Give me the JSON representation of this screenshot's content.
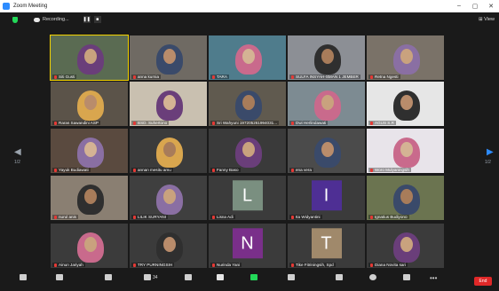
{
  "window": {
    "title": "Zoom Meeting",
    "controls": [
      "–",
      "▢",
      "✕"
    ]
  },
  "topbar": {
    "recording": "Recording...",
    "view": "View"
  },
  "pagination": {
    "left": "1/2",
    "right": "1/2"
  },
  "participants": [
    {
      "name": "Siti Gusti"
    },
    {
      "name": "anna kurnia"
    },
    {
      "name": "TARA"
    },
    {
      "name": "SULFA INSYAH-SMAN 1 JEMBER"
    },
    {
      "name": "Retna Ngesti"
    },
    {
      "name": "Raras Sawandini ASP"
    },
    {
      "name": "BSD. Suhertono"
    },
    {
      "name": "Sri Wahyuni 197205261994031..."
    },
    {
      "name": "Dwi Herlindawati"
    },
    {
      "name": "AGUS S.R"
    },
    {
      "name": "Yayuk Budiawati"
    },
    {
      "name": "annan mesitu amu"
    },
    {
      "name": "Fanny Baso"
    },
    {
      "name": "ena vera"
    },
    {
      "name": "Woro Mulyaningsih"
    },
    {
      "name": "nurul anis"
    },
    {
      "name": "LILIK SURYANI"
    },
    {
      "name": "Lisna Adi",
      "letter": "L"
    },
    {
      "name": "Ita Widyantini",
      "letter": "I"
    },
    {
      "name": "Ignatius Budiyono"
    },
    {
      "name": "Ainun Jariyah"
    },
    {
      "name": "TRY PURNINGSIH"
    },
    {
      "name": "Nurinda Yani",
      "letter": "N"
    },
    {
      "name": "Tike Fitriningsih, Spd",
      "letter": "T"
    },
    {
      "name": "Diana Novita sari"
    }
  ],
  "toolbar": {
    "participants_count": "34",
    "end": "End"
  }
}
